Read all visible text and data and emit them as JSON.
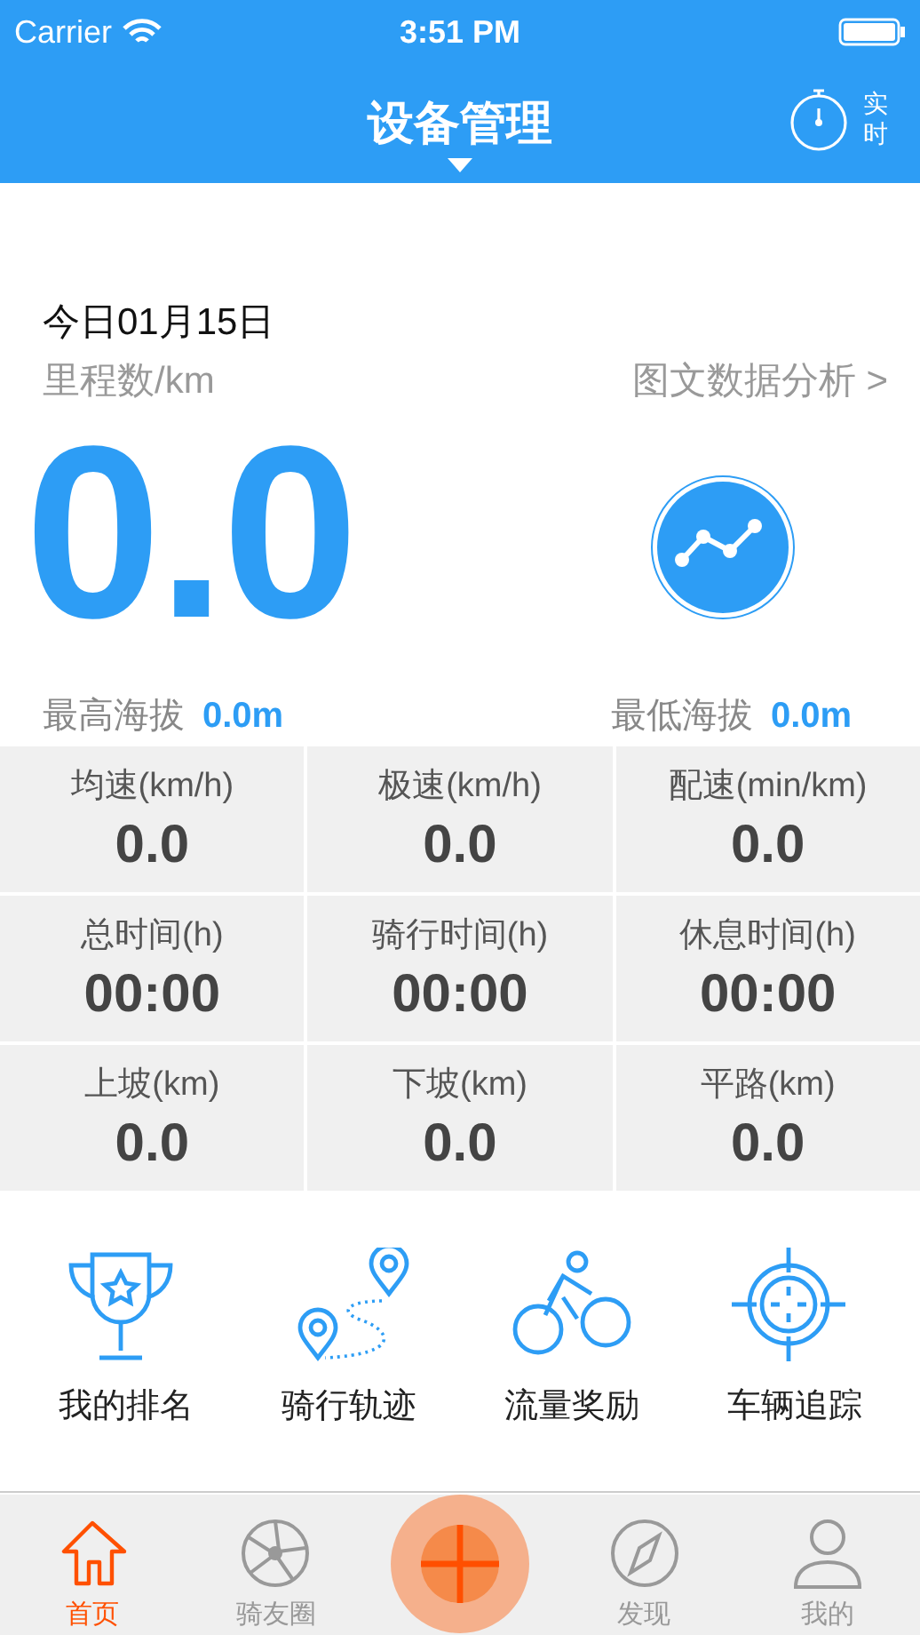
{
  "status_bar": {
    "carrier": "Carrier",
    "time": "3:51 PM"
  },
  "nav": {
    "title": "设备管理",
    "realtime_label": "实时"
  },
  "summary": {
    "date": "今日01月15日",
    "distance_label": "里程数/km",
    "analysis_link": "图文数据分析 >",
    "distance": "0.0",
    "max_altitude_label": "最高海拔",
    "max_altitude": "0.0m",
    "min_altitude_label": "最低海拔",
    "min_altitude": "0.0m"
  },
  "stats": [
    {
      "label": "均速(km/h)",
      "value": "0.0"
    },
    {
      "label": "极速(km/h)",
      "value": "0.0"
    },
    {
      "label": "配速(min/km)",
      "value": "0.0"
    },
    {
      "label": "总时间(h)",
      "value": "00:00"
    },
    {
      "label": "骑行时间(h)",
      "value": "00:00"
    },
    {
      "label": "休息时间(h)",
      "value": "00:00"
    },
    {
      "label": "上坡(km)",
      "value": "0.0"
    },
    {
      "label": "下坡(km)",
      "value": "0.0"
    },
    {
      "label": "平路(km)",
      "value": "0.0"
    }
  ],
  "shortcuts": [
    {
      "label": "我的排名",
      "kind": "trophy"
    },
    {
      "label": "骑行轨迹",
      "kind": "route"
    },
    {
      "label": "流量奖励",
      "kind": "bike"
    },
    {
      "label": "车辆追踪",
      "kind": "target"
    }
  ],
  "tabs": [
    {
      "label": "首页",
      "kind": "home",
      "selected": true
    },
    {
      "label": "骑友圈",
      "kind": "wheel",
      "selected": false
    },
    {
      "kind": "add",
      "selected": false
    },
    {
      "label": "发现",
      "kind": "compass",
      "selected": false
    },
    {
      "label": "我的",
      "kind": "person",
      "selected": false
    }
  ]
}
